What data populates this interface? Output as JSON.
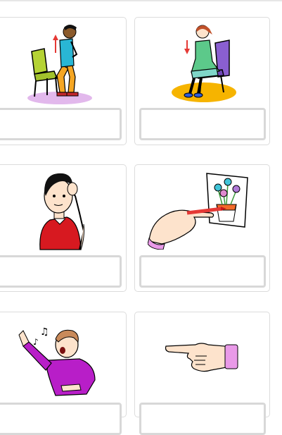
{
  "exercise": {
    "cards": [
      {
        "picture": "man-standing-up-from-chair",
        "answer": ""
      },
      {
        "picture": "girl-sitting-down-on-chair",
        "answer": ""
      },
      {
        "picture": "boy-scratching-head-thinking",
        "answer": ""
      },
      {
        "picture": "hand-drawing-flowers",
        "answer": ""
      },
      {
        "picture": "man-singing",
        "answer": ""
      },
      {
        "picture": "hand-pointing",
        "answer": ""
      }
    ]
  },
  "colors": {
    "card_border": "#dcdcdc",
    "answer_border": "#d8d8d8",
    "chair_green": "#b5d334",
    "chair_purple": "#8a5fd0",
    "red_shirt": "#d71920",
    "magenta_shirt": "#b81ec8"
  }
}
